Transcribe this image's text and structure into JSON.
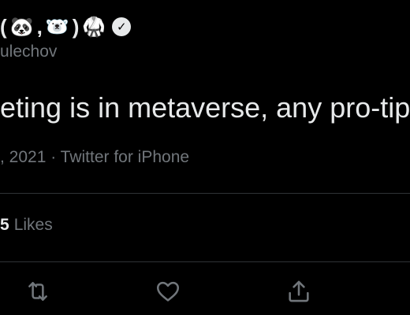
{
  "profile": {
    "display_name_emoji": [
      "(",
      "🐼",
      ",",
      "🐻‍❄️",
      ")",
      "🥋"
    ],
    "handle": "ulechov",
    "verified_icon": "verified-badge-icon"
  },
  "tweet": {
    "text": "eting is in metaverse, any pro-tip",
    "meta": ", 2021 · Twitter for iPhone"
  },
  "stats": {
    "likes_count": "5",
    "likes_label": "Likes"
  },
  "actions": {
    "icons": [
      "retweet-icon",
      "like-icon",
      "share-icon"
    ]
  },
  "colors": {
    "background": "#000000",
    "primary_text": "#e7e9ea",
    "secondary_text": "#71767b",
    "divider": "#2f3336"
  }
}
